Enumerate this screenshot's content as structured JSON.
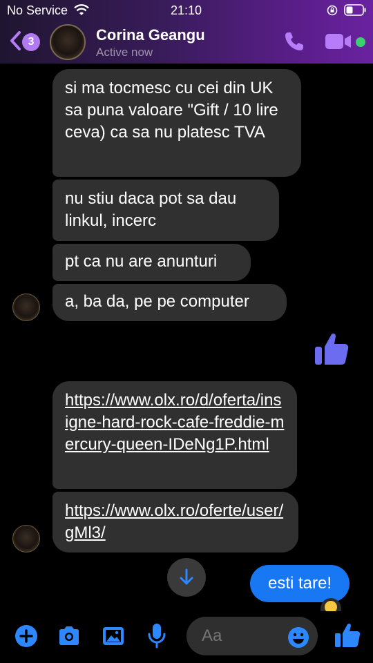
{
  "status_bar": {
    "carrier": "No Service",
    "time": "21:10"
  },
  "header": {
    "unread_count": "3",
    "contact_name": "Corina Geangu",
    "contact_status": "Active now"
  },
  "messages": [
    {
      "text": "si ma tocmesc cu cei din UK sa puna valoare \"Gift / 10 lire ceva) ca sa nu platesc TVA"
    },
    {
      "text": "nu stiu daca pot sa dau linkul, incerc"
    },
    {
      "text": "pt ca nu are anunturi"
    },
    {
      "text": "a, ba da, pe pe computer"
    },
    {
      "text": "https://www.olx.ro/d/oferta/insigne-hard-rock-cafe-freddie-mercury-queen-IDeNg1P.html"
    },
    {
      "text": "https://www.olx.ro/oferte/user/gMl3/"
    }
  ],
  "my_message": {
    "text": "esti tare!"
  },
  "composer": {
    "placeholder": "Aa"
  },
  "colors": {
    "accent": "#1877f2",
    "header_purple": "#5a1e8a",
    "call_icon": "#b77cf7",
    "online": "#3bd16f"
  }
}
